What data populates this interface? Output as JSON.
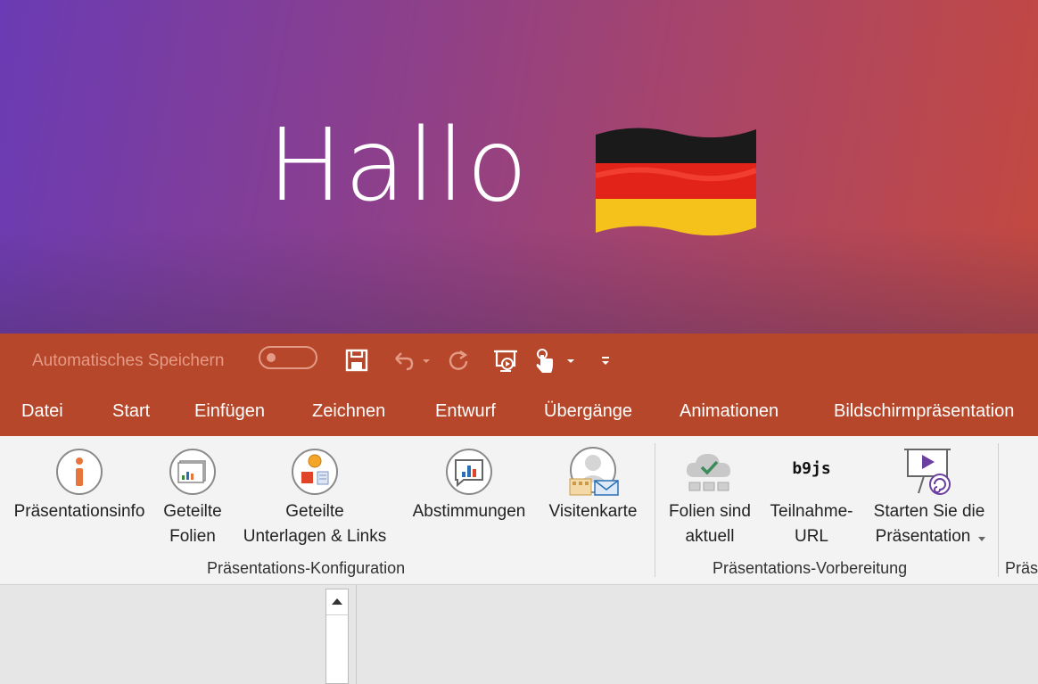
{
  "hero": {
    "title": "Hallo",
    "flag": "germany-flag"
  },
  "qat": {
    "autosave_label": "Automatisches Speichern",
    "icons": [
      "save-icon",
      "undo-icon",
      "redo-icon",
      "present-icon",
      "touch-mode-icon",
      "customize-icon"
    ]
  },
  "tabs": [
    "Datei",
    "Start",
    "Einfügen",
    "Zeichnen",
    "Entwurf",
    "Übergänge",
    "Animationen",
    "Bildschirmpräsentation"
  ],
  "ribbon": {
    "group1": {
      "label": "Präsentations-Konfiguration",
      "buttons": [
        {
          "line1": "Präsentationsinfo",
          "line2": ""
        },
        {
          "line1": "Geteilte",
          "line2": "Folien"
        },
        {
          "line1": "Geteilte",
          "line2": "Unterlagen & Links"
        },
        {
          "line1": "Abstimmungen",
          "line2": ""
        },
        {
          "line1": "Visitenkarte",
          "line2": ""
        }
      ]
    },
    "group2": {
      "label": "Präsentations-Vorbereitung",
      "buttons": [
        {
          "line1": "Folien sind",
          "line2": "aktuell"
        },
        {
          "line1": "Teilnahme-",
          "line2": "URL",
          "icon_text": "b9js"
        },
        {
          "line1": "Starten Sie die",
          "line2": "Präsentation"
        }
      ]
    },
    "group3": {
      "label": "Präs"
    }
  },
  "colors": {
    "accent": "#b7472a",
    "ribbon_bg": "#f3f3f3"
  }
}
